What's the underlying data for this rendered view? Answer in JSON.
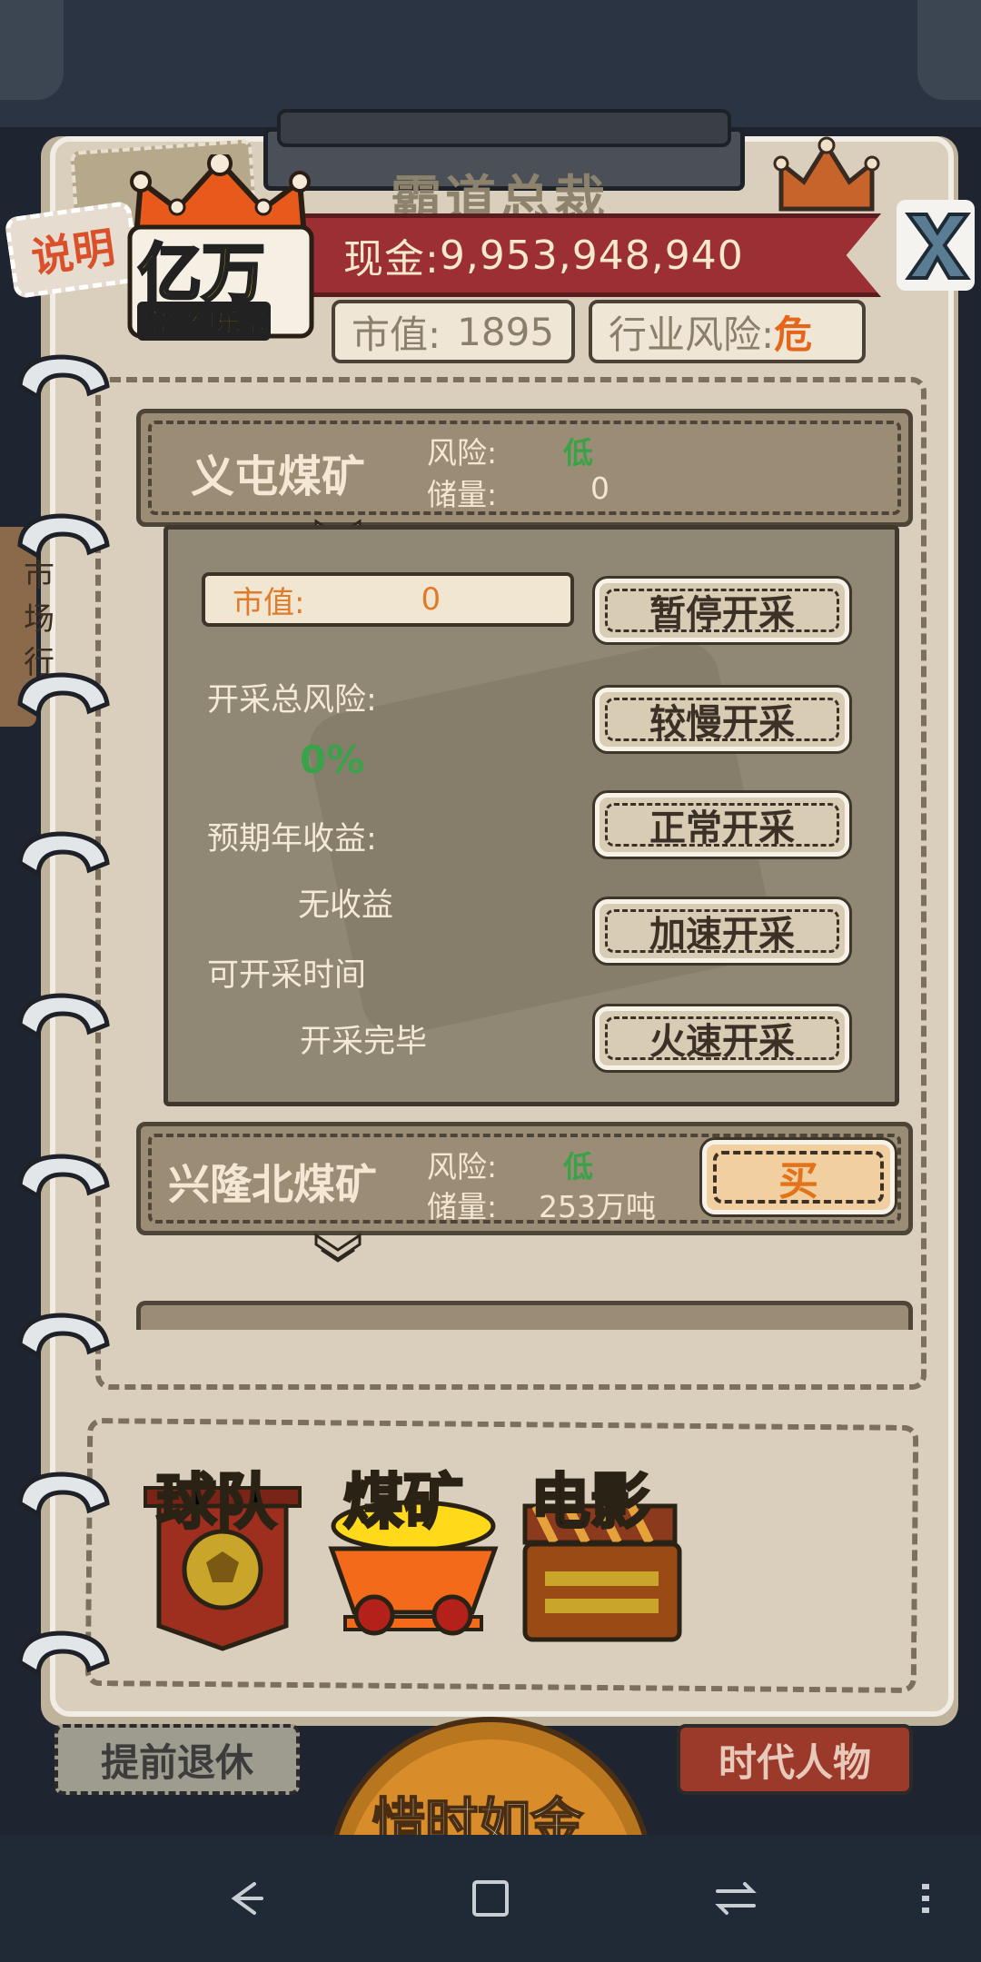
{
  "header": {
    "back_title": "霸道总裁",
    "explain_label": "说明",
    "club_big": "亿万",
    "club_small": "富翁俱乐部",
    "cash_label": "现金:",
    "cash_value": "9,953,948,940",
    "market_label": "市值:",
    "market_value": "1895",
    "risk_label": "行业风险:",
    "risk_value": "危"
  },
  "side_text": "市场行",
  "mines": [
    {
      "name": "义屯煤矿",
      "risk_label": "风险:",
      "risk_value": "低",
      "reserve_label": "储量:",
      "reserve_value": "0"
    },
    {
      "name": "兴隆北煤矿",
      "risk_label": "风险:",
      "risk_value": "低",
      "reserve_label": "储量:",
      "reserve_value": "253万吨",
      "buy_label": "买"
    }
  ],
  "panel": {
    "market_label": "市值:",
    "market_value": "0",
    "total_risk_label": "开采总风险:",
    "total_risk_value": "0%",
    "income_label": "预期年收益:",
    "income_value": "无收益",
    "time_label": "可开采时间",
    "time_value": "开采完毕",
    "buttons": [
      "暂停开采",
      "较慢开采",
      "正常开采",
      "加速开采",
      "火速开采"
    ]
  },
  "categories": [
    {
      "label": "球队",
      "color": "#c9a52a"
    },
    {
      "label": "煤矿",
      "color": "#ffe31a"
    },
    {
      "label": "电影",
      "color": "#c9a52a"
    }
  ],
  "bottom": {
    "retire_label": "提前退休",
    "clock_label": "惜时如金",
    "figures_label": "时代人物"
  },
  "colors": {
    "paper": "#d9cfbc",
    "ribbon": "#9b2f33",
    "risk_low": "#3ba24a",
    "danger": "#e5651a"
  }
}
